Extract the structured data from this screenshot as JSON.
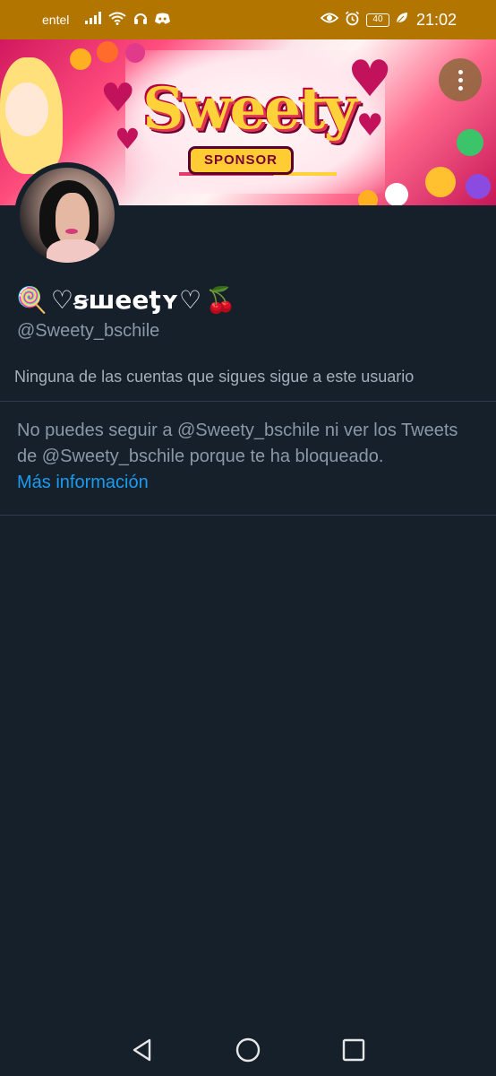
{
  "status_bar": {
    "carrier": "entel",
    "battery": "40",
    "time": "21:02",
    "icons": [
      "signal-icon",
      "wifi-icon",
      "headset-icon",
      "discord-icon",
      "eye-icon",
      "alarm-icon",
      "battery-icon",
      "leaf-icon"
    ]
  },
  "banner": {
    "logo_text": "Sweety",
    "tag_text": "SPONSOR"
  },
  "profile": {
    "display_name_prefix": "🍭",
    "display_name": "♡ꞩꟺeeƫʏ♡",
    "display_name_suffix": "🍒",
    "handle": "@Sweety_bschile",
    "followers_note": "Ninguna de las cuentas que sigues sigue a este usuario"
  },
  "blocked": {
    "message": "No puedes seguir a @Sweety_bschile ni ver los Tweets de @Sweety_bschile porque te ha bloqueado.",
    "link": "Más información"
  },
  "colors": {
    "background": "#15202b",
    "status_bar": "#b27600",
    "link": "#1d9bf0",
    "secondary_text": "#8b98a5"
  }
}
